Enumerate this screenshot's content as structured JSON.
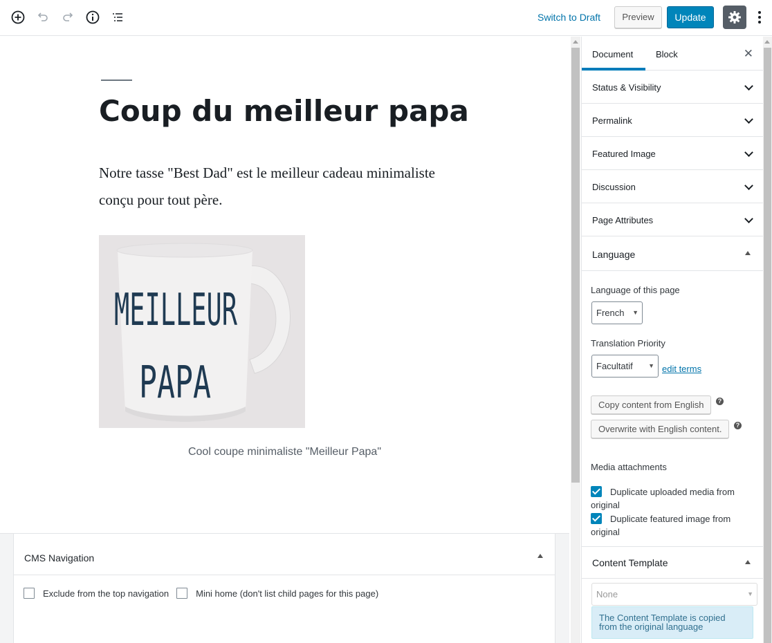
{
  "toolbar": {
    "switch_to_draft": "Switch to Draft",
    "preview": "Preview",
    "update": "Update",
    "icons": [
      "add-block-icon",
      "undo-icon",
      "redo-icon",
      "info-icon",
      "outline-icon",
      "gear-icon",
      "more-vertical-icon"
    ]
  },
  "editor": {
    "title": "Coup du meilleur papa",
    "paragraph": "Notre tasse \"Best Dad\" est le meilleur cadeau minimaliste conçu pour tout père.",
    "image": {
      "line1": "MEILLEUR",
      "line2": "PAPA"
    },
    "caption": "Cool coupe minimaliste \"Meilleur Papa\""
  },
  "cms": {
    "title": "CMS Navigation",
    "exclude_label": "Exclude from the top navigation",
    "mini_home_label": "Mini home (don't list child pages for this page)"
  },
  "sidebar": {
    "tabs": [
      {
        "label": "Document",
        "active": true
      },
      {
        "label": "Block",
        "active": false
      }
    ],
    "close": "✕",
    "panels": [
      "Status & Visibility",
      "Permalink",
      "Featured Image",
      "Discussion",
      "Page Attributes"
    ],
    "language": {
      "title": "Language",
      "lang_label": "Language of this page",
      "lang_value": "French",
      "priority_label": "Translation Priority",
      "priority_value": "Facultatif",
      "edit_terms": "edit terms",
      "copy_button": "Copy content from English",
      "overwrite_button": "Overwrite with English content.",
      "help": "?",
      "media_label": "Media attachments",
      "dup_media": "Duplicate uploaded media from original",
      "dup_featured": "Duplicate featured image from original"
    },
    "content_template": {
      "title": "Content Template",
      "value": "None",
      "note": "The Content Template is copied from the original language"
    }
  },
  "colors": {
    "accent": "#0085ba",
    "link": "#0073aa",
    "mug_text": "#1f3a52"
  }
}
